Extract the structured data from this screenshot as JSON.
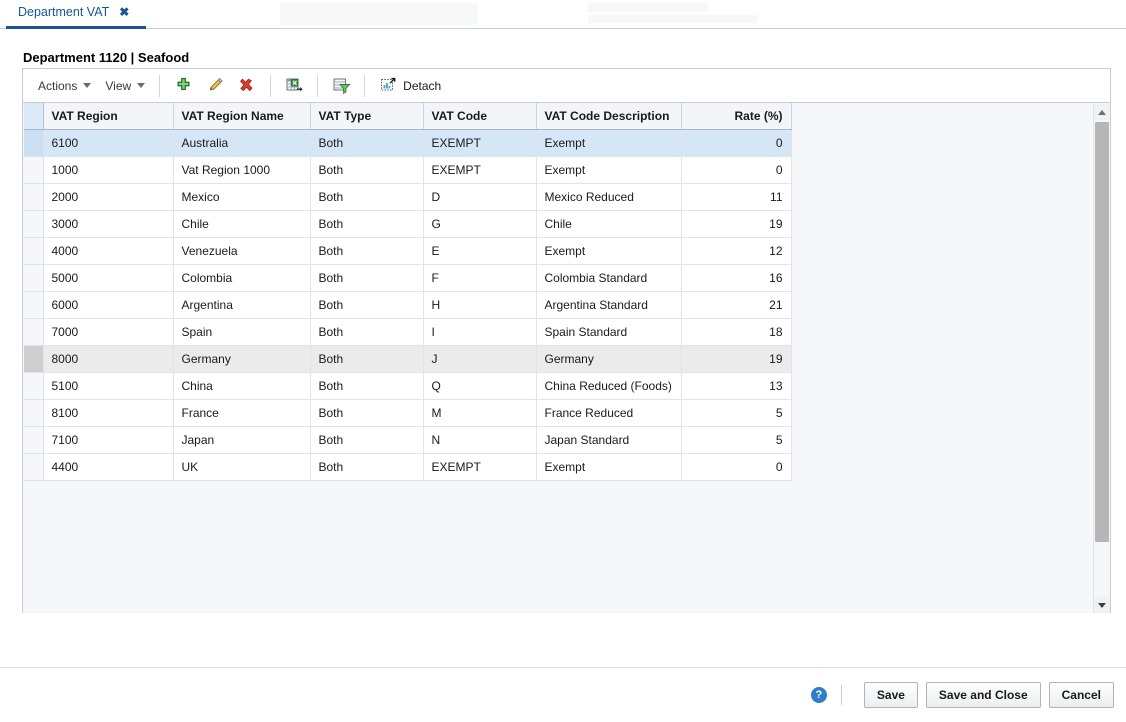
{
  "tab": {
    "label": "Department VAT",
    "close_glyph": "✖"
  },
  "page": {
    "title": "Department 1120 | Seafood"
  },
  "toolbar": {
    "actions_label": "Actions",
    "view_label": "View",
    "detach_label": "Detach",
    "icons": {
      "add": "add-icon",
      "edit": "edit-pencil-icon",
      "delete": "delete-x-icon",
      "export": "export-to-excel-icon",
      "query": "query-filter-icon",
      "detach": "detach-icon"
    }
  },
  "table": {
    "columns": [
      {
        "label": "VAT Region",
        "align": "left"
      },
      {
        "label": "VAT Region Name",
        "align": "left"
      },
      {
        "label": "VAT Type",
        "align": "left"
      },
      {
        "label": "VAT Code",
        "align": "left"
      },
      {
        "label": "VAT Code Description",
        "align": "left"
      },
      {
        "label": "Rate (%)",
        "align": "right"
      }
    ],
    "rows": [
      {
        "region": "6100",
        "region_name": "Australia",
        "vat_type": "Both",
        "vat_code": "EXEMPT",
        "description": "Exempt",
        "rate": "0",
        "state": "selected"
      },
      {
        "region": "1000",
        "region_name": "Vat Region 1000",
        "vat_type": "Both",
        "vat_code": "EXEMPT",
        "description": "Exempt",
        "rate": "0",
        "state": "normal"
      },
      {
        "region": "2000",
        "region_name": "Mexico",
        "vat_type": "Both",
        "vat_code": "D",
        "description": "Mexico Reduced",
        "rate": "11",
        "state": "normal"
      },
      {
        "region": "3000",
        "region_name": "Chile",
        "vat_type": "Both",
        "vat_code": "G",
        "description": "Chile",
        "rate": "19",
        "state": "normal"
      },
      {
        "region": "4000",
        "region_name": "Venezuela",
        "vat_type": "Both",
        "vat_code": "E",
        "description": "Exempt",
        "rate": "12",
        "state": "normal"
      },
      {
        "region": "5000",
        "region_name": "Colombia",
        "vat_type": "Both",
        "vat_code": "F",
        "description": "Colombia Standard",
        "rate": "16",
        "state": "normal"
      },
      {
        "region": "6000",
        "region_name": "Argentina",
        "vat_type": "Both",
        "vat_code": "H",
        "description": "Argentina Standard",
        "rate": "21",
        "state": "normal"
      },
      {
        "region": "7000",
        "region_name": "Spain",
        "vat_type": "Both",
        "vat_code": "I",
        "description": "Spain Standard",
        "rate": "18",
        "state": "normal"
      },
      {
        "region": "8000",
        "region_name": "Germany",
        "vat_type": "Both",
        "vat_code": "J",
        "description": "Germany",
        "rate": "19",
        "state": "hover"
      },
      {
        "region": "5100",
        "region_name": "China",
        "vat_type": "Both",
        "vat_code": "Q",
        "description": "China Reduced (Foods)",
        "rate": "13",
        "state": "normal"
      },
      {
        "region": "8100",
        "region_name": "France",
        "vat_type": "Both",
        "vat_code": "M",
        "description": "France Reduced",
        "rate": "5",
        "state": "normal"
      },
      {
        "region": "7100",
        "region_name": "Japan",
        "vat_type": "Both",
        "vat_code": "N",
        "description": "Japan Standard",
        "rate": "5",
        "state": "normal"
      },
      {
        "region": "4400",
        "region_name": "UK",
        "vat_type": "Both",
        "vat_code": "EXEMPT",
        "description": "Exempt",
        "rate": "0",
        "state": "normal"
      }
    ]
  },
  "footer": {
    "help_glyph": "?",
    "save_label": "Save",
    "save_close_label": "Save and Close",
    "cancel_label": "Cancel"
  },
  "colors": {
    "tab_accent": "#1a5694",
    "tab_text": "#155799",
    "row_selected": "#d5e7f7",
    "row_hover": "#ebebeb",
    "header_bg": "#f3f5f8",
    "panel_bg": "#f5f7fa",
    "help_blue": "#2f7fc4"
  }
}
